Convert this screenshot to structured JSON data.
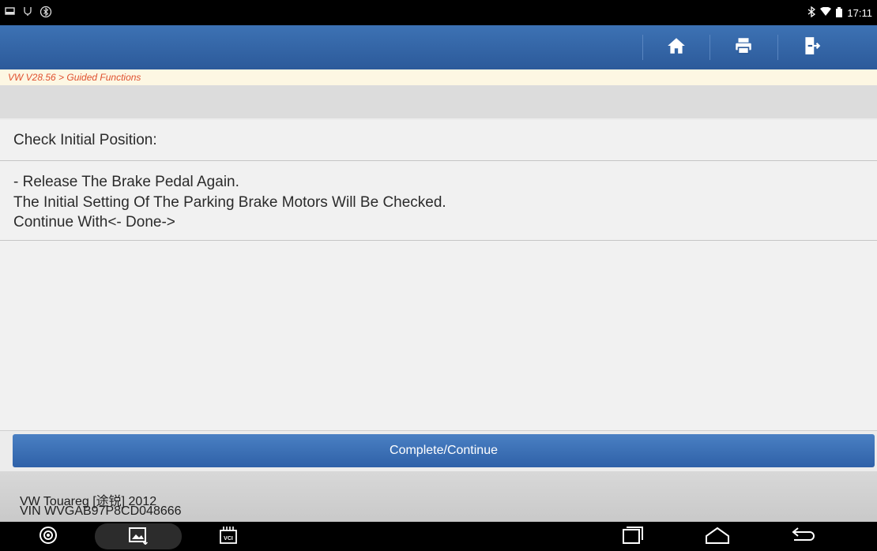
{
  "status_bar": {
    "time": "17:11"
  },
  "header": {
    "buttons": [
      {
        "name": "home",
        "icon": "home-icon"
      },
      {
        "name": "print",
        "icon": "printer-icon"
      },
      {
        "name": "exit",
        "icon": "exit-icon"
      }
    ]
  },
  "breadcrumb": {
    "text": "VW V28.56 > Guided Functions"
  },
  "content": {
    "title": "Check Initial Position:",
    "message_lines": [
      "- Release The Brake Pedal Again.",
      "The Initial Setting Of The Parking Brake Motors Will Be Checked.",
      "Continue With<- Done->"
    ]
  },
  "action_button": {
    "label": "Complete/Continue"
  },
  "footer": {
    "vehicle": "VW Touareg [途锐] 2012",
    "vin": "VIN WVGAB97P8CD048666"
  },
  "navbar": {
    "vci_label": "VCI"
  },
  "colors": {
    "header_blue": "#2c5a9a",
    "breadcrumb_text": "#e0502e",
    "button_blue": "#3a6db3"
  }
}
